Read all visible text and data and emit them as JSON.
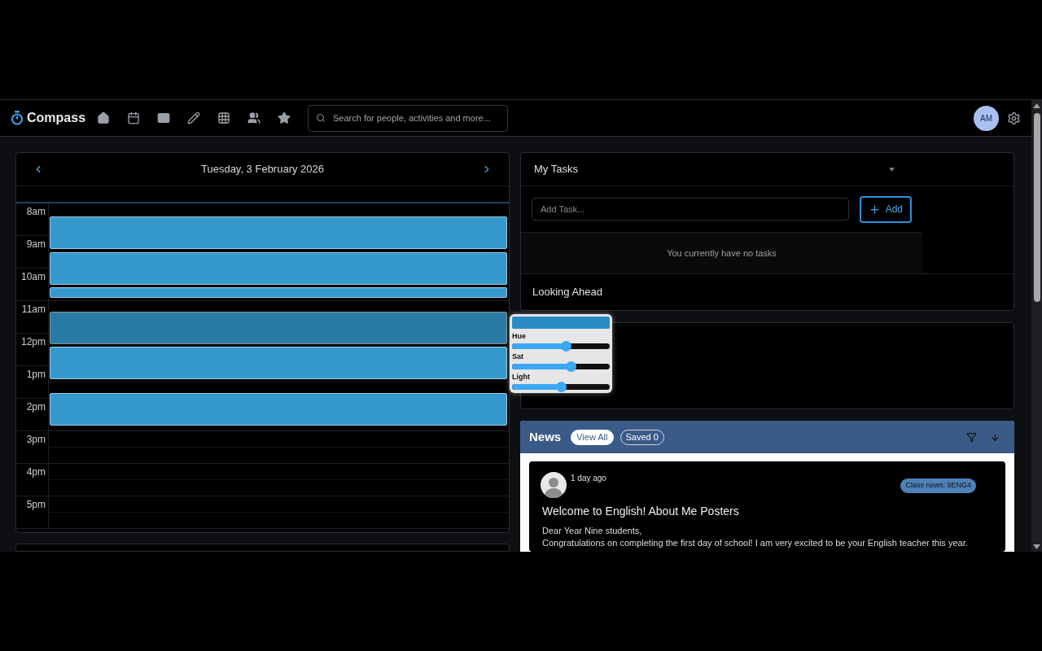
{
  "brand": "Compass",
  "search": {
    "placeholder": "Search for people, activities and more..."
  },
  "avatar": "AM",
  "calendar": {
    "date": "Tuesday, 3 February 2026",
    "hours": [
      "8am",
      "9am",
      "10am",
      "11am",
      "12pm",
      "1pm",
      "2pm",
      "3pm",
      "4pm",
      "5pm"
    ],
    "events": [
      {
        "selected": false
      },
      {
        "selected": false
      },
      {
        "selected": false
      },
      {
        "selected": true
      },
      {
        "selected": false
      },
      {
        "selected": false
      }
    ]
  },
  "color_picker": {
    "color": "#2a8cc4",
    "sliders": [
      {
        "label": "Hue",
        "level": 0.55
      },
      {
        "label": "Sat",
        "level": 0.6
      },
      {
        "label": "Light",
        "level": 0.5
      }
    ]
  },
  "tasks": {
    "title": "My Tasks",
    "input": {
      "placeholder": "Add Task..."
    },
    "add_button": "Add",
    "empty_message": "You currently have no tasks",
    "section": "Looking Ahead"
  },
  "news": {
    "title": "News",
    "filters": [
      {
        "label": "View All",
        "selected": true
      },
      {
        "label": "Saved 0",
        "selected": false
      }
    ],
    "posts": [
      {
        "time": "1 day ago",
        "tag": "Class news: 9ENG4",
        "title": "Welcome to English! About Me Posters",
        "body": [
          "Dear Year Nine students,",
          "Congratulations on completing the first day of school! I am very excited to be your English teacher this year."
        ]
      }
    ]
  }
}
